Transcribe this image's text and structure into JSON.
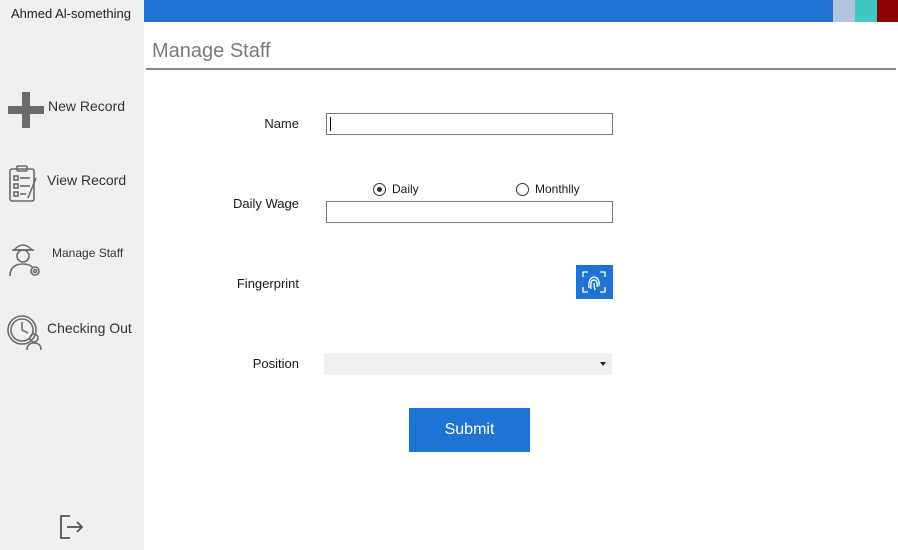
{
  "user": {
    "name": "Ahmed Al-something"
  },
  "sidebar": {
    "items": [
      {
        "label": "New Record",
        "icon": "plus-icon"
      },
      {
        "label": "View Record",
        "icon": "checklist-clipboard-icon"
      },
      {
        "label": "Manage Staff",
        "icon": "worker-settings-icon"
      },
      {
        "label": "Checking Out",
        "icon": "clock-person-icon"
      }
    ],
    "logout_icon": "logout-icon"
  },
  "window": {
    "accent_color": "#1e73d3",
    "buttons": [
      {
        "icon": "minimize-icon",
        "color": "#b0c4de"
      },
      {
        "icon": "maximize-icon",
        "color": "#40c8c0"
      },
      {
        "icon": "close-icon",
        "color": "#8b0000"
      }
    ]
  },
  "page": {
    "title": "Manage Staff"
  },
  "form": {
    "name": {
      "label": "Name",
      "value": ""
    },
    "daily_wage": {
      "label": "Daily Wage",
      "value": "",
      "options": [
        {
          "label": "Daily",
          "checked": true
        },
        {
          "label": "Monthlly",
          "checked": false
        }
      ]
    },
    "fingerprint": {
      "label": "Fingerprint",
      "button_icon": "fingerprint-icon"
    },
    "position": {
      "label": "Position",
      "selected": ""
    },
    "submit_label": "Submit"
  }
}
